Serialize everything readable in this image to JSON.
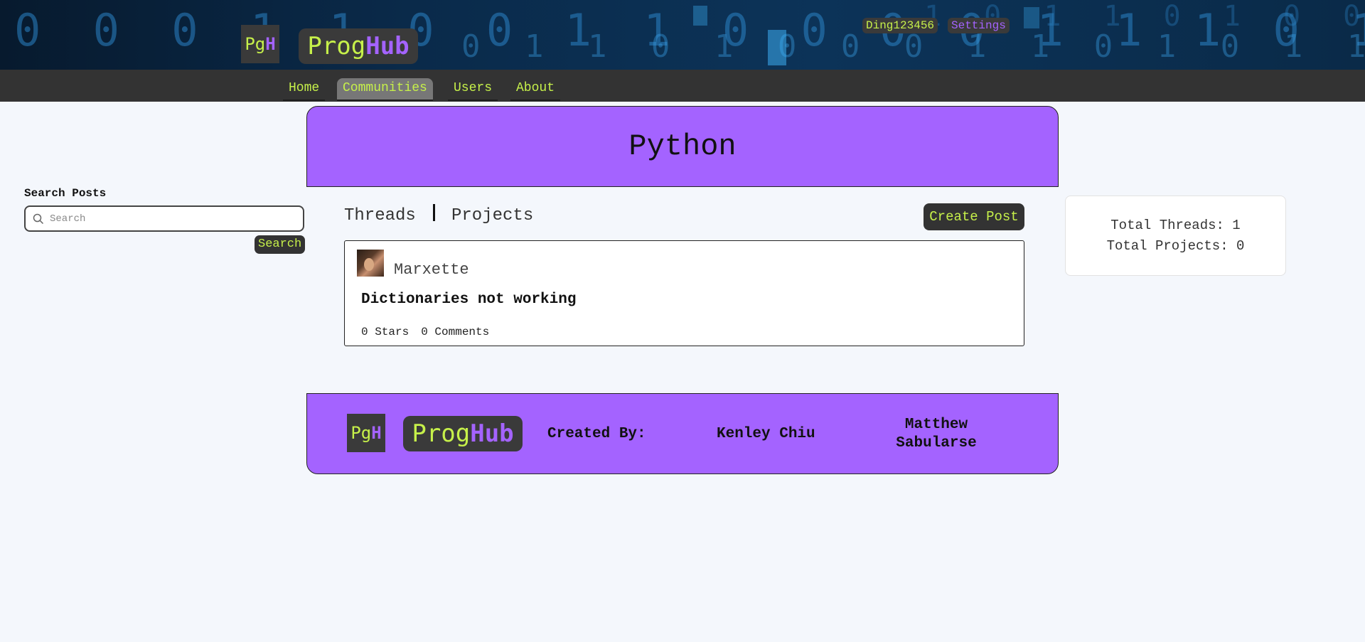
{
  "header": {
    "logo_short": {
      "pg": "Pg",
      "h": "H"
    },
    "logo_full": {
      "prog": "Prog",
      "hub": "Hub"
    },
    "username": "Ding123456",
    "settings_label": "Settings"
  },
  "nav": {
    "items": [
      {
        "label": "Home",
        "active": false
      },
      {
        "label": "Communities",
        "active": true
      },
      {
        "label": "Users",
        "active": false
      },
      {
        "label": "About",
        "active": false
      }
    ]
  },
  "community": {
    "title": "Python"
  },
  "sidebar": {
    "search_label": "Search Posts",
    "search_placeholder": "Search",
    "search_value": "",
    "search_button": "Search"
  },
  "tabs": {
    "threads": "Threads",
    "projects": "Projects",
    "create_post": "Create Post"
  },
  "posts": [
    {
      "author": "Marxette",
      "title": "Dictionaries not working",
      "stars": "0 Stars",
      "comments": "0 Comments"
    }
  ],
  "stats": {
    "total_threads": "Total Threads: 1",
    "total_projects": "Total Projects: 0"
  },
  "footer": {
    "created_by": "Created By:",
    "author1": "Kenley Chiu",
    "author2_line1": "Matthew",
    "author2_line2": "Sabularse"
  },
  "colors": {
    "accent_green": "#c6f04a",
    "accent_purple": "#a463ff",
    "dark": "#333333",
    "background": "#f4f7fc"
  }
}
